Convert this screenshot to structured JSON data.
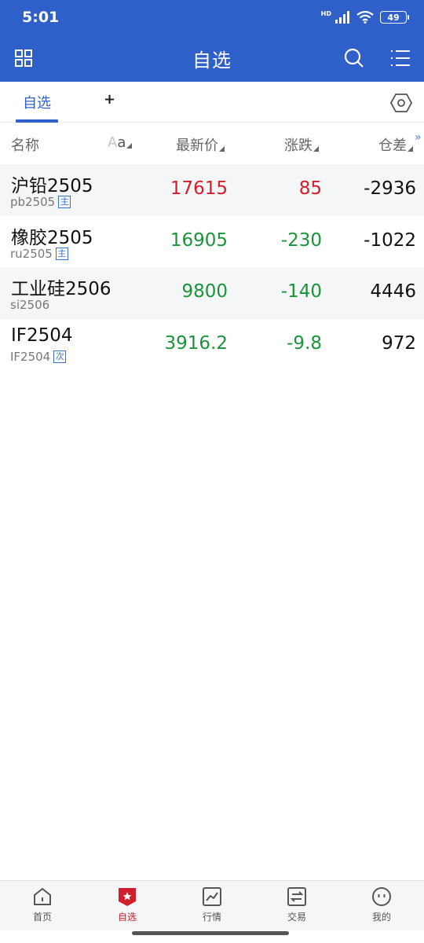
{
  "status": {
    "time": "5:01",
    "hd": "HD",
    "battery": "49"
  },
  "header": {
    "title": "自选"
  },
  "tabs": {
    "active_label": "自选",
    "add_label": "+"
  },
  "columns": {
    "name": "名称",
    "font_a1": "A",
    "font_a2": "a",
    "price": "最新价",
    "change": "涨跌",
    "open_interest_change": "仓差",
    "more": "»"
  },
  "rows": [
    {
      "name": "沪铅2505",
      "code": "pb2505",
      "badge": "主",
      "price": "17615",
      "change": "85",
      "oi": "-2936",
      "color": "red"
    },
    {
      "name": "橡胶2505",
      "code": "ru2505",
      "badge": "主",
      "price": "16905",
      "change": "-230",
      "oi": "-1022",
      "color": "green"
    },
    {
      "name": "工业硅2506",
      "code": "si2506",
      "badge": "",
      "price": "9800",
      "change": "-140",
      "oi": "4446",
      "color": "green"
    },
    {
      "name": "IF2504",
      "code": "IF2504",
      "badge": "次",
      "price": "3916.2",
      "change": "-9.8",
      "oi": "972",
      "color": "green"
    }
  ],
  "nav": {
    "home": "首页",
    "watchlist": "自选",
    "market": "行情",
    "trade": "交易",
    "mine": "我的"
  },
  "colors": {
    "brand_blue": "#2f5fc9",
    "up_red": "#d21d2b",
    "down_green": "#1a9438"
  }
}
